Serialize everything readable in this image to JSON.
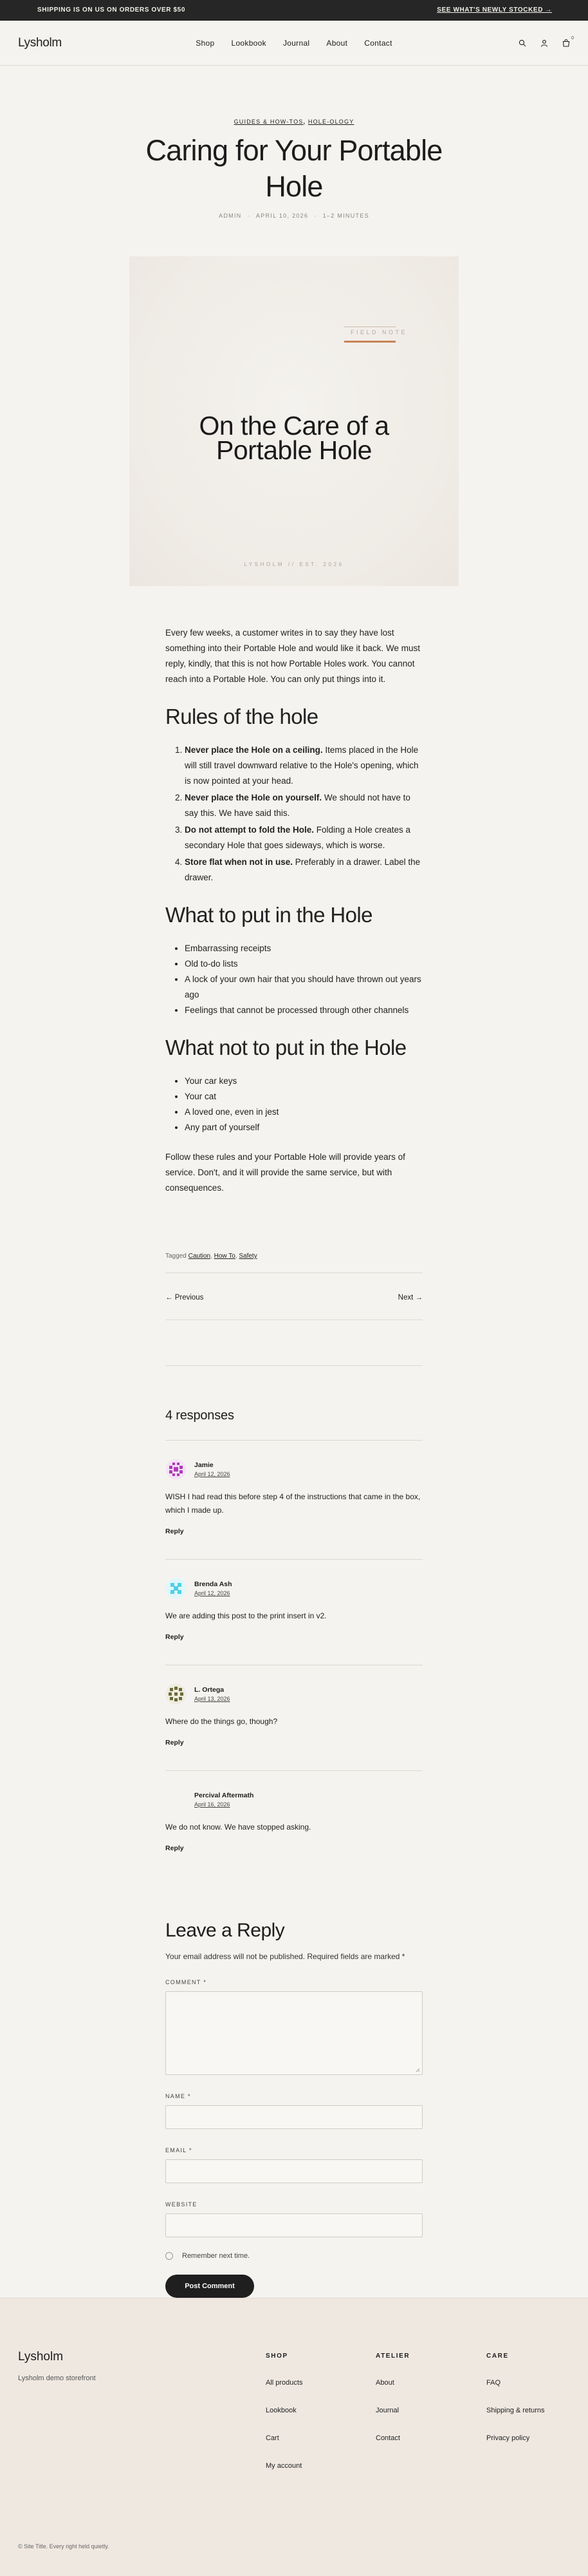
{
  "announce": {
    "left": "SHIPPING IS ON US ON ORDERS OVER $50",
    "right": "SEE WHAT'S NEWLY STOCKED →"
  },
  "header": {
    "logo": "Lysholm",
    "nav": [
      "Shop",
      "Lookbook",
      "Journal",
      "About",
      "Contact"
    ],
    "cart_count": "0"
  },
  "post": {
    "categories": [
      "GUIDES & HOW-TOS",
      "HOLE-OLOGY"
    ],
    "title": "Caring for Your Portable Hole",
    "author": "ADMIN",
    "date": "APRIL 10, 2026",
    "read_time": "1–2 MINUTES"
  },
  "hero": {
    "eyebrow": "FIELD NOTE",
    "title_line1": "On the Care of a",
    "title_line2": "Portable Hole",
    "footer": "LYSHOLM  //  EST. 2026"
  },
  "content": {
    "intro": "Every few weeks, a customer writes in to say they have lost something into their Portable Hole and would like it back. We must reply, kindly, that this is not how Portable Holes work. You cannot reach into a Portable Hole. You can only put things into it.",
    "h_rules": "Rules of the hole",
    "rules": [
      {
        "bold": "Never place the Hole on a ceiling.",
        "text": " Items placed in the Hole will still travel downward relative to the Hole's opening, which is now pointed at your head."
      },
      {
        "bold": "Never place the Hole on yourself.",
        "text": " We should not have to say this. We have said this."
      },
      {
        "bold": "Do not attempt to fold the Hole.",
        "text": " Folding a Hole creates a secondary Hole that goes sideways, which is worse."
      },
      {
        "bold": "Store flat when not in use.",
        "text": " Preferably in a drawer. Label the drawer."
      }
    ],
    "h_put": "What to put in the Hole",
    "put": [
      "Embarrassing receipts",
      "Old to-do lists",
      "A lock of your own hair that you should have thrown out years ago",
      "Feelings that cannot be processed through other channels"
    ],
    "h_not": "What not to put in the Hole",
    "not_put": [
      "Your car keys",
      "Your cat",
      "A loved one, even in jest",
      "Any part of yourself"
    ],
    "closing": "Follow these rules and your Portable Hole will provide years of service. Don't, and it will provide the same service, but with consequences."
  },
  "tags": {
    "label": "Tagged",
    "items": [
      "Caution",
      "How To",
      "Safety"
    ]
  },
  "pager": {
    "prev": "← Previous",
    "next": "Next →"
  },
  "responses": {
    "title": "4 responses",
    "reply_label": "Reply",
    "items": [
      {
        "name": "Jamie",
        "date": "April 12, 2026",
        "body": "WISH I had read this before step 4 of the instructions that came in the box, which I made up.",
        "avatar": "magenta"
      },
      {
        "name": "Brenda Ash",
        "date": "April 12, 2026",
        "body": "We are adding this post to the print insert in v2.",
        "avatar": "cyan"
      },
      {
        "name": "L. Ortega",
        "date": "April 13, 2026",
        "body": "Where do the things go, though?",
        "avatar": "olive"
      },
      {
        "name": "Percival Aftermath",
        "date": "April 16, 2026",
        "body": "We do not know. We have stopped asking.",
        "avatar": "none"
      }
    ]
  },
  "reply_form": {
    "title": "Leave a Reply",
    "note": "Your email address will not be published. Required fields are marked *",
    "comment_label": "COMMENT *",
    "name_label": "NAME *",
    "email_label": "EMAIL *",
    "website_label": "WEBSITE",
    "remember": "Remember next time.",
    "submit": "Post Comment"
  },
  "footer": {
    "logo": "Lysholm",
    "tagline": "Lysholm demo storefront",
    "cols": [
      {
        "title": "SHOP",
        "items": [
          "All products",
          "Lookbook",
          "Cart",
          "My account"
        ]
      },
      {
        "title": "ATELIER",
        "items": [
          "About",
          "Journal",
          "Contact"
        ]
      },
      {
        "title": "CARE",
        "items": [
          "FAQ",
          "Shipping & returns",
          "Privacy policy"
        ]
      }
    ],
    "copyright": "© Site Title. Every right held quietly."
  },
  "colors": {
    "accent": "#c98356",
    "background": "#f5f3ef",
    "footer_bg": "#efe8e1"
  }
}
